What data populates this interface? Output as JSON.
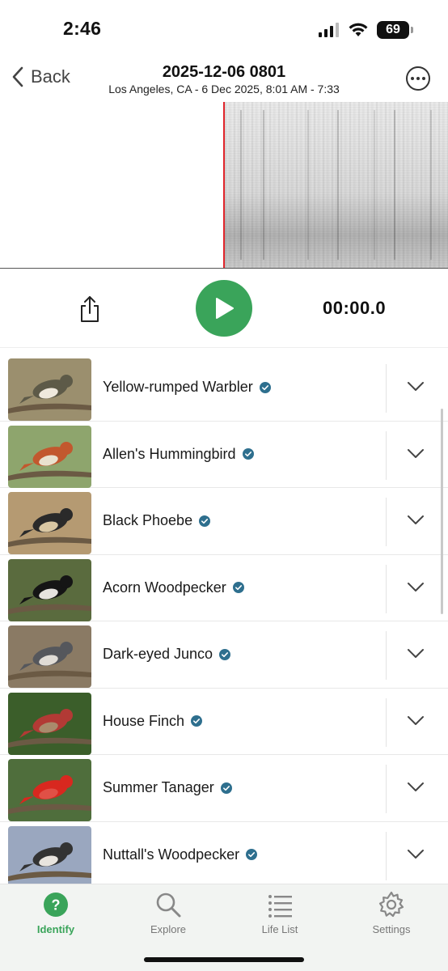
{
  "status_bar": {
    "time": "2:46",
    "battery": "69"
  },
  "nav": {
    "back_label": "Back",
    "title": "2025-12-06 0801",
    "subtitle": "Los Angeles, CA - 6 Dec 2025, 8:01 AM - 7:33"
  },
  "player": {
    "timer": "00:00.0"
  },
  "colors": {
    "accent": "#3aa45a",
    "playhead": "#e0252b",
    "verified": "#2e6f8e"
  },
  "species": [
    {
      "name": "Yellow-rumped Warbler"
    },
    {
      "name": "Allen's Hummingbird"
    },
    {
      "name": "Black Phoebe"
    },
    {
      "name": "Acorn Woodpecker"
    },
    {
      "name": "Dark-eyed Junco"
    },
    {
      "name": "House Finch"
    },
    {
      "name": "Summer Tanager"
    },
    {
      "name": "Nuttall's Woodpecker"
    }
  ],
  "tabs": [
    {
      "label": "Identify",
      "icon": "question-circle-icon",
      "active": true
    },
    {
      "label": "Explore",
      "icon": "search-icon",
      "active": false
    },
    {
      "label": "Life List",
      "icon": "list-icon",
      "active": false
    },
    {
      "label": "Settings",
      "icon": "gear-icon",
      "active": false
    }
  ]
}
